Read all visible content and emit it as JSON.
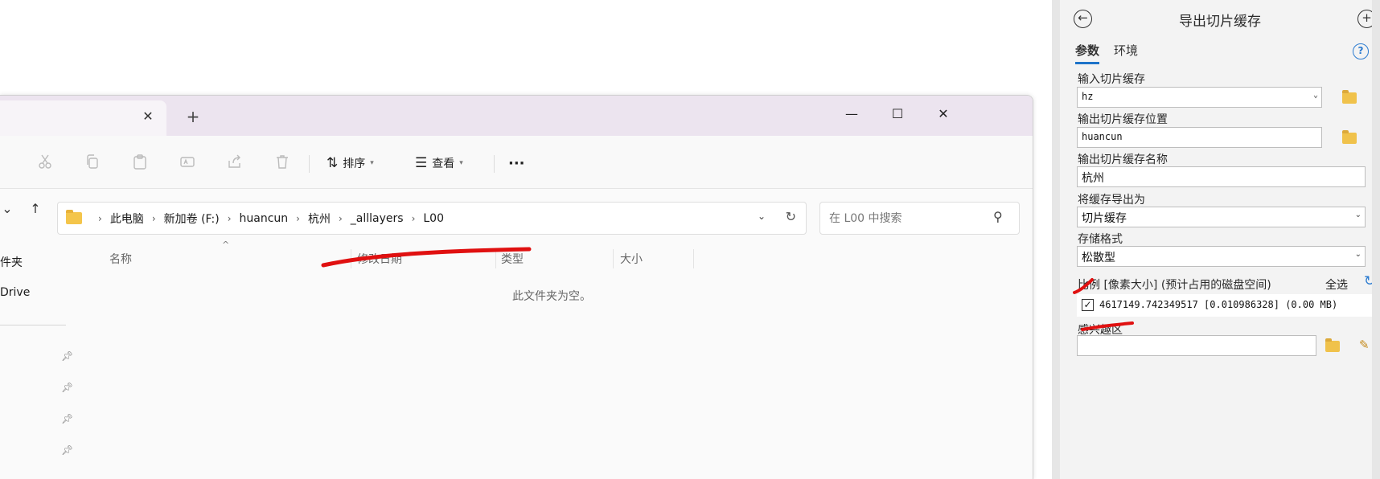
{
  "explorer": {
    "tab_close_glyph": "✕",
    "new_tab_glyph": "+",
    "window_controls": {
      "minimize": "—",
      "maximize": "☐",
      "close": "✕"
    },
    "toolbar": {
      "icons": [
        "cut-icon",
        "copy-icon",
        "paste-icon",
        "rename-icon",
        "share-icon",
        "delete-icon"
      ],
      "sort_label": "排序",
      "view_label": "查看",
      "more_glyph": "···"
    },
    "breadcrumb": [
      "此电脑",
      "新加卷 (F:)",
      "huancun",
      "杭州",
      "_alllayers",
      "L00"
    ],
    "search_placeholder": "在 L00 中搜索",
    "nav_items": [
      "件夹",
      "Drive"
    ],
    "columns": [
      "名称",
      "修改日期",
      "类型",
      "大小"
    ],
    "empty_message": "此文件夹为空。"
  },
  "gp": {
    "title": "导出切片缓存",
    "tabs": [
      "参数",
      "环境"
    ],
    "help_glyph": "?",
    "input_cache_label": "输入切片缓存",
    "input_cache_value": "hz",
    "output_location_label": "输出切片缓存位置",
    "output_location_value": "huancun",
    "output_name_label": "输出切片缓存名称",
    "output_name_value": "杭州",
    "export_as_label": "将缓存导出为",
    "export_as_value": "切片缓存",
    "storage_format_label": "存储格式",
    "storage_format_value": "松散型",
    "scale_label": "比例 [像素大小] (预计占用的磁盘空间)",
    "select_all": "全选",
    "scale_item": "4617149.742349517 [0.010986328] (0.00 MB)",
    "scale_item_checked": true,
    "aoi_label": "感兴趣区"
  },
  "colors": {
    "accent": "#1d73c9",
    "annotation": "#e01010",
    "folder": "#f4c54b"
  }
}
